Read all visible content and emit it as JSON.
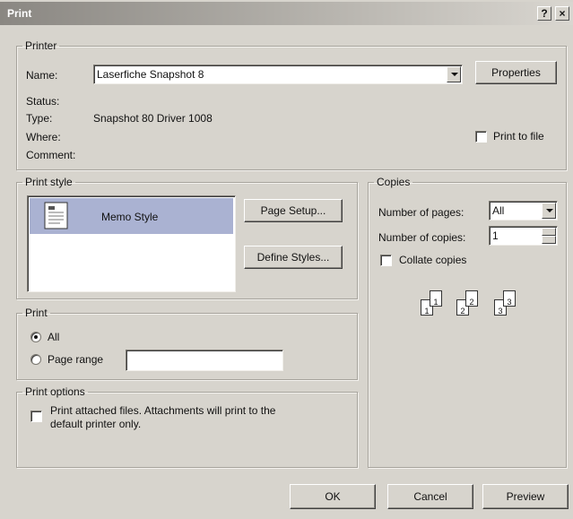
{
  "window": {
    "title": "Print",
    "help": "?",
    "close": "×"
  },
  "printer": {
    "legend": "Printer",
    "name_label": "Name:",
    "name_value": "Laserfiche Snapshot 8",
    "properties_label": "Properties",
    "status_label": "Status:",
    "status_value": "",
    "type_label": "Type:",
    "type_value": "Snapshot 80 Driver 1008",
    "where_label": "Where:",
    "where_value": "",
    "comment_label": "Comment:",
    "comment_value": "",
    "print_to_file_label": "Print to file",
    "print_to_file_checked": false
  },
  "print_style": {
    "legend": "Print style",
    "styles": [
      "Memo Style"
    ],
    "selected": "Memo Style",
    "page_setup_label": "Page Setup...",
    "define_styles_label": "Define Styles..."
  },
  "copies": {
    "legend": "Copies",
    "pages_label": "Number of pages:",
    "pages_value": "All",
    "copies_label": "Number of copies:",
    "copies_value": "1",
    "collate_label": "Collate copies",
    "collate_checked": false,
    "collate_pages": [
      "1",
      "1",
      "2",
      "2",
      "3",
      "3"
    ]
  },
  "print_range": {
    "legend": "Print",
    "all_label": "All",
    "page_range_label": "Page range",
    "page_range_value": "",
    "selected": "All"
  },
  "print_options": {
    "legend": "Print options",
    "attached_line1": "Print attached files.  Attachments will print to the",
    "attached_line2": "default printer only.",
    "attached_checked": false
  },
  "footer": {
    "ok_label": "OK",
    "cancel_label": "Cancel",
    "preview_label": "Preview"
  },
  "colors": {
    "dialog_bg": "#d7d4cd",
    "selection_bg": "#aab2d2",
    "titlebar_start": "#8a8782"
  }
}
